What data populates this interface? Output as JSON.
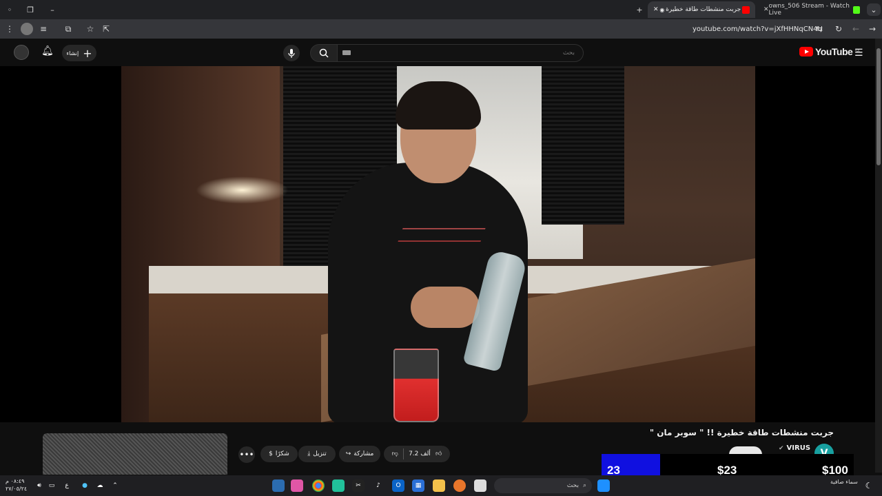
{
  "browser": {
    "tabs": [
      {
        "label": "owns_506 Stream - Watch Live",
        "active": false
      },
      {
        "label": "جربت منشطات طاقة خطيرة",
        "active": true
      }
    ],
    "url": "youtube.com/watch?v=jXfHHNqCN4U"
  },
  "youtube": {
    "logo_text": "YouTube",
    "region": "SA",
    "search_placeholder": "بحث",
    "create_label": "إنشاء"
  },
  "video": {
    "title": "جربت منشطات طاقة خطيرة !! \" سوبر مان \"",
    "channel_name": "VIRUS",
    "channel_initial": "V",
    "likes": "7.2 ألف",
    "share_label": "مشاركة",
    "download_label": "تنزيل",
    "thanks_label": "شكرًا"
  },
  "overlay": {
    "count": "23",
    "amount_mid": "$23",
    "amount_right": "$100",
    "accent": "#1010e0"
  },
  "taskbar": {
    "search_label": "بحث",
    "time": "٠٨:٤٩ م",
    "date": "٢٧/٠٥/٢٤",
    "lang": "ع",
    "weather": "سماء صافية"
  },
  "colors": {
    "youtube_red": "#ff0000",
    "background": "#0f0f0f"
  }
}
